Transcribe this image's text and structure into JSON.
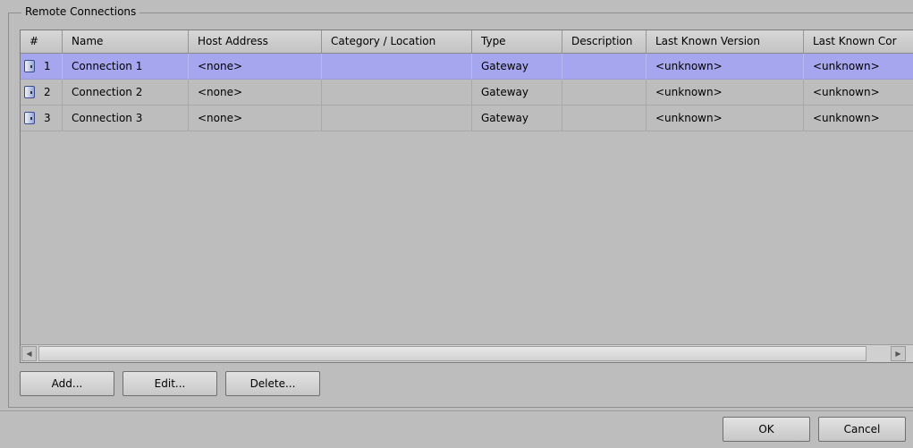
{
  "group_title": "Remote Connections",
  "columns": [
    {
      "label": "#"
    },
    {
      "label": "Name"
    },
    {
      "label": "Host Address"
    },
    {
      "label": "Category / Location"
    },
    {
      "label": "Type"
    },
    {
      "label": "Description"
    },
    {
      "label": "Last Known Version"
    },
    {
      "label": "Last Known Cor"
    }
  ],
  "rows": [
    {
      "num": "1",
      "name": "Connection 1",
      "host": "<none>",
      "category": "",
      "type": "Gateway",
      "description": "",
      "version": "<unknown>",
      "last": "<unknown>",
      "selected": true
    },
    {
      "num": "2",
      "name": "Connection 2",
      "host": "<none>",
      "category": "",
      "type": "Gateway",
      "description": "",
      "version": "<unknown>",
      "last": "<unknown>",
      "selected": false
    },
    {
      "num": "3",
      "name": "Connection 3",
      "host": "<none>",
      "category": "",
      "type": "Gateway",
      "description": "",
      "version": "<unknown>",
      "last": "<unknown>",
      "selected": false
    }
  ],
  "buttons": {
    "add": "Add...",
    "edit": "Edit...",
    "delete": "Delete...",
    "ok": "OK",
    "cancel": "Cancel"
  },
  "icons": {
    "row_icon": "device-icon",
    "scroll_left": "scroll-left-arrow-icon",
    "scroll_right": "scroll-right-arrow-icon"
  },
  "colors": {
    "background": "#bdbdbd",
    "selected_row": "#a6a6ef"
  }
}
